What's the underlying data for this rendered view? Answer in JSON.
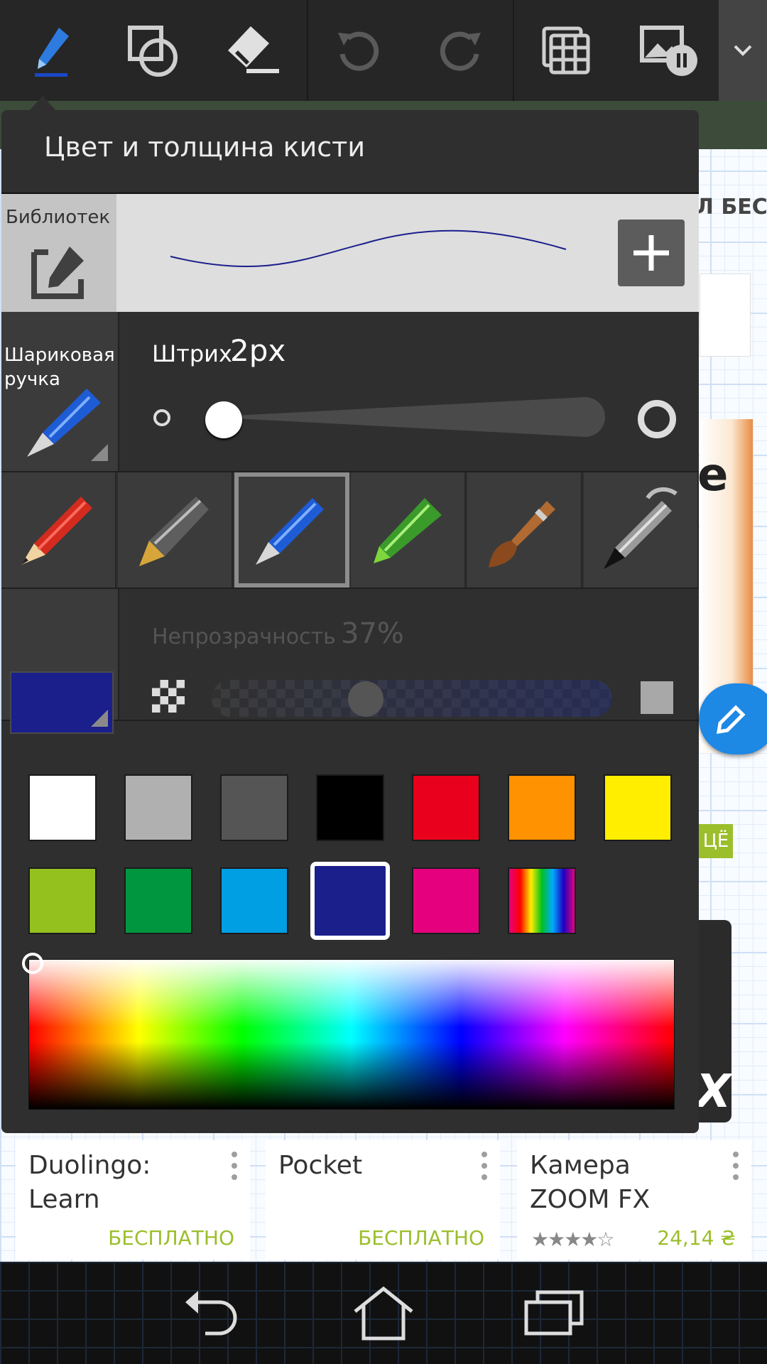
{
  "panel": {
    "title": "Цвет и толщина кисти",
    "library_label": "Библиотек",
    "brush_label": "Шариковая ручка",
    "stroke_label": "Штрих",
    "stroke_value": "2px",
    "opacity_label": "Непрозрачность",
    "opacity_value": "37%",
    "current_color": "#1a1f8c",
    "tools": [
      "pencil",
      "fountain-pen",
      "ballpoint-pen",
      "marker",
      "paintbrush",
      "airbrush"
    ],
    "selected_tool": "ballpoint-pen",
    "palette_row1": [
      "#ffffff",
      "#b0b0b0",
      "#555555",
      "#000000",
      "#e8001c",
      "#ff9200",
      "#ffee00"
    ],
    "palette_row2": [
      "#95c11f",
      "#009640",
      "#009fe3",
      "#1a1f8c",
      "#e5007d",
      "rainbow"
    ],
    "selected_swatch": "#1a1f8c"
  },
  "background": {
    "header_fragment": "Л БЕСПЛ",
    "tag_fragment": "ЦЁ",
    "apps": [
      {
        "title": "Duolingo: Learn",
        "price": "БЕСПЛАТНО"
      },
      {
        "title": "Pocket",
        "price": "БЕСПЛАТНО"
      },
      {
        "title": "Камера ZOOM FX",
        "price": "24,14 ₴",
        "rating": "★★★★☆"
      }
    ]
  }
}
